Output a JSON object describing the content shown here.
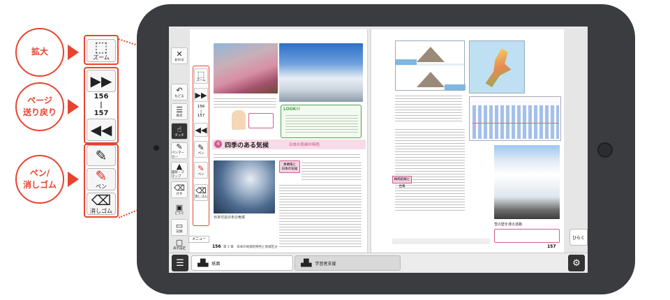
{
  "callouts": {
    "zoom": "拡大",
    "page": "ページ\n送り戻り",
    "pen": "ペン/\n消しゴム"
  },
  "panel": {
    "zoom_label": "ズーム",
    "page_top": "156",
    "page_bottom": "157",
    "pen_label": "ペン",
    "eraser_label": "消しゴム"
  },
  "toolbar": {
    "close": "おわる",
    "back": "もどる",
    "index": "目次",
    "touch": "タッチ",
    "pen_marker": "ペンマーカー",
    "stamp": "図形・スタンプ",
    "eraser": "けす",
    "tools": "どうぐ",
    "record": "記録",
    "display": "表示設定",
    "menu": "メニュー"
  },
  "overlay": {
    "zoom": "ズーム",
    "page_top": "156",
    "page_bottom": "157",
    "pen": "ペン",
    "eraser": "消しゴム"
  },
  "book": {
    "left_page_no": "156",
    "right_page_no": "157",
    "section_no": "4",
    "section_title": "四季のある気候",
    "subsection": "日本の気候の特色",
    "look_label": "LOOK!!",
    "seasonal_wind": "季節風と\n日本の気候",
    "left_footer": "第 3 章　日本の地域的特色と地域区分",
    "caption_topo": "日本付近の冬の気候",
    "caption_snow": "雪の壁を通る道路",
    "sea_label": "梅雨前線と台風"
  },
  "bottom": {
    "tab_textbook": "紙面",
    "tab_support": "学習者支援",
    "open_button": "ひらく"
  },
  "icons": {
    "zoom": "magnifier-icon",
    "next": "fast-forward-icon",
    "prev": "rewind-icon",
    "pen": "pen-icon",
    "eraser": "eraser-icon",
    "menu": "hamburger-icon",
    "settings": "gear-icon",
    "book": "book-icon"
  },
  "colors": {
    "accent": "#e8432f",
    "tablet": "#3b3c40",
    "section_pink": "#d25b8f",
    "look_green": "#4ba24a"
  }
}
